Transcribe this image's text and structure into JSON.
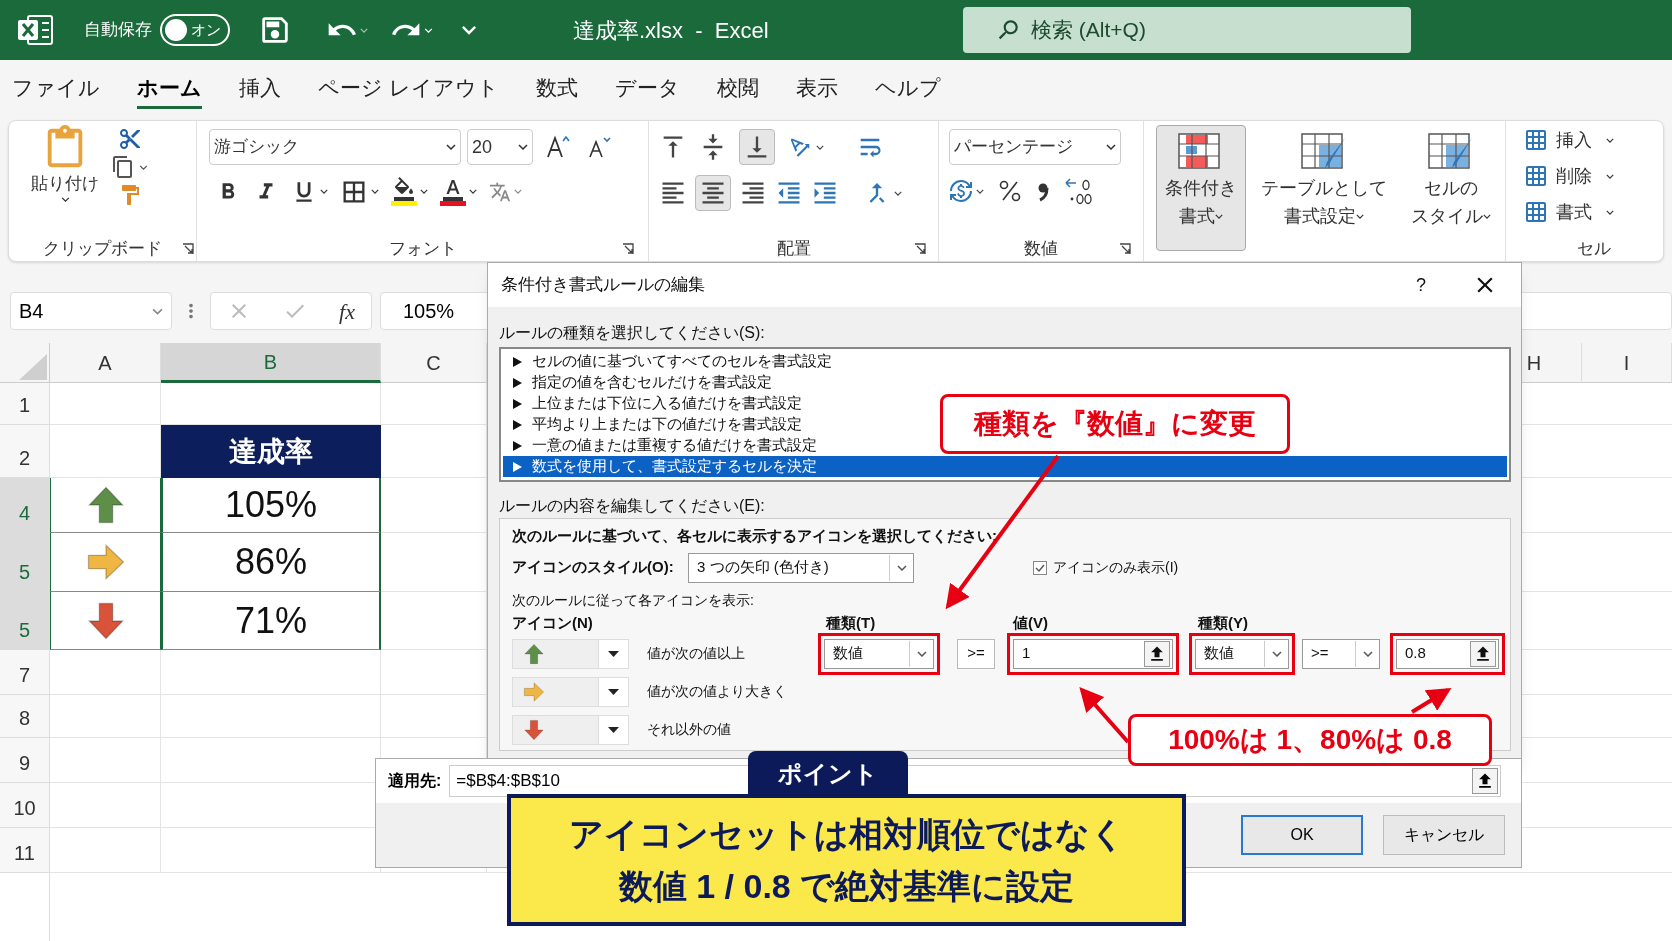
{
  "title_bar": {
    "autosave_label": "自動保存",
    "autosave_toggle": {
      "label": "オン"
    },
    "document_title": "達成率.xlsx  -  Excel",
    "search_placeholder": "検索 (Alt+Q)"
  },
  "menu_tabs": [
    {
      "label": "ファイル",
      "selected": false
    },
    {
      "label": "ホーム",
      "selected": true
    },
    {
      "label": "挿入",
      "selected": false
    },
    {
      "label": "ページ レイアウト",
      "selected": false
    },
    {
      "label": "数式",
      "selected": false
    },
    {
      "label": "データ",
      "selected": false
    },
    {
      "label": "校閲",
      "selected": false
    },
    {
      "label": "表示",
      "selected": false
    },
    {
      "label": "ヘルプ",
      "selected": false
    }
  ],
  "ribbon": {
    "clipboard": {
      "paste": "貼り付け",
      "label": "クリップボード"
    },
    "font": {
      "name": "游ゴシック",
      "size": "20",
      "label": "フォント"
    },
    "alignment": {
      "label": "配置"
    },
    "number": {
      "format": "パーセンテージ",
      "label": "数値"
    },
    "styles": [
      {
        "line1": "条件付き",
        "line2": "書式",
        "selected": true
      },
      {
        "line1": "テーブルとして",
        "line2": "書式設定",
        "selected": false
      },
      {
        "line1": "セルの",
        "line2": "スタイル",
        "selected": false
      }
    ],
    "cells": {
      "items": [
        "挿入",
        "削除",
        "書式"
      ],
      "label": "セル"
    }
  },
  "formula_bar": {
    "name_box": "B4",
    "fx": "fx",
    "value": "105%"
  },
  "sheet": {
    "columns": [
      {
        "label": "A",
        "selected": false
      },
      {
        "label": "B",
        "selected": true
      },
      {
        "label": "C",
        "selected": false
      },
      {
        "label": "H",
        "selected": false
      },
      {
        "label": "I",
        "selected": false
      }
    ],
    "rows": [
      {
        "number": "1",
        "selected": false,
        "kind": "blank"
      },
      {
        "number": "2",
        "selected": false,
        "kind": "header",
        "value": "達成率"
      },
      {
        "number": "4",
        "selected": true,
        "kind": "data",
        "icon": {
          "kind": "up"
        },
        "value": "105%"
      },
      {
        "number": "5",
        "selected": true,
        "kind": "data",
        "icon": {
          "kind": "right"
        },
        "value": "86%"
      },
      {
        "number": "5",
        "selected": true,
        "kind": "data",
        "icon": {
          "kind": "down"
        },
        "value": "71%"
      },
      {
        "number": "7",
        "selected": false,
        "kind": "blank"
      },
      {
        "number": "8",
        "selected": false,
        "kind": "blank"
      },
      {
        "number": "9",
        "selected": false,
        "kind": "blank"
      },
      {
        "number": "10",
        "selected": false,
        "kind": "blank"
      },
      {
        "number": "11",
        "selected": false,
        "kind": "blank"
      }
    ]
  },
  "dialog": {
    "title": "条件付き書式ルールの編集",
    "help": "?",
    "rule_type_label": "ルールの種類を選択してください(S):",
    "rule_types": [
      {
        "label": "セルの値に基づいてすべてのセルを書式設定",
        "selected": false
      },
      {
        "label": "指定の値を含むセルだけを書式設定",
        "selected": false
      },
      {
        "label": "上位または下位に入る値だけを書式設定",
        "selected": false
      },
      {
        "label": "平均より上または下の値だけを書式設定",
        "selected": false
      },
      {
        "label": "一意の値または重複する値だけを書式設定",
        "selected": false
      },
      {
        "label": "数式を使用して、書式設定するセルを決定",
        "selected": true
      }
    ],
    "edit_label": "ルールの内容を編集してください(E):",
    "instruction": "次のルールに基づいて、各セルに表示するアイコンを選択してください:",
    "icon_style": {
      "label": "アイコンのスタイル(O):",
      "value": "3 つの矢印 (色付き)"
    },
    "icon_only": {
      "label": "アイコンのみ表示(I)",
      "checked": true
    },
    "rules_caption": "次のルールに従って各アイコンを表示:",
    "icon_column_label": "アイコン(N)",
    "type_label": "種類(T)",
    "value_label": "値(V)",
    "type2_label": "種類(Y)",
    "icon_rules": [
      {
        "kind": "up",
        "condition": "値が次の値以上",
        "thresholds": [
          {
            "type": "数値",
            "operator": ">=",
            "kind": "box",
            "value": "1"
          },
          {
            "type": "数値",
            "operator": ">=",
            "kind": "dropdown",
            "value": "0.8"
          }
        ]
      },
      {
        "kind": "right",
        "condition": "値が次の値より大きく"
      },
      {
        "kind": "down",
        "condition": "それ以外の値"
      }
    ],
    "applies_to": {
      "label": "適用先:",
      "value": "=$B$4:$B$10"
    },
    "buttons": [
      {
        "label": "OK",
        "kind": "default"
      },
      {
        "label": "キャンセル",
        "kind": "normal"
      }
    ]
  },
  "annotations": {
    "callouts": [
      {
        "text": "種類を『数値』に変更"
      },
      {
        "text": "100%は 1、80%は 0.8"
      }
    ],
    "point": {
      "badge": "ポイント",
      "lines": [
        "アイコンセットは相対順位ではなく",
        "数値 1 / 0.8 で絶対基準に設定"
      ]
    }
  }
}
